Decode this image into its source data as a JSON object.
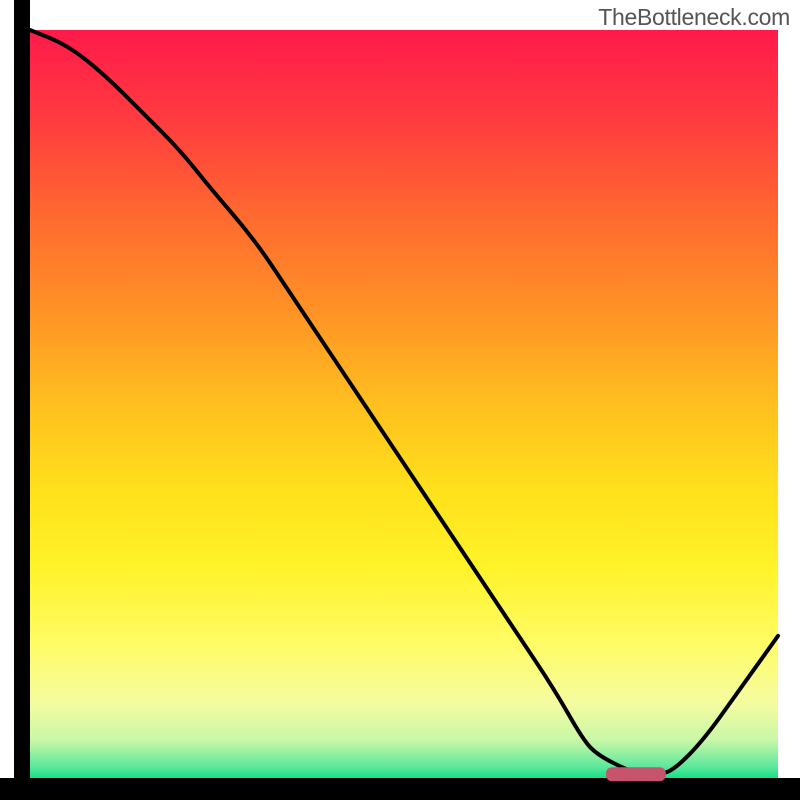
{
  "watermark": "TheBottleneck.com",
  "chart_data": {
    "type": "line",
    "title": "",
    "xlabel": "",
    "ylabel": "",
    "xlim": [
      0,
      100
    ],
    "ylim": [
      0,
      100
    ],
    "x": [
      0,
      5,
      10,
      15,
      20,
      24,
      30,
      35,
      40,
      45,
      50,
      55,
      60,
      65,
      70,
      74,
      76,
      80,
      82,
      84,
      86,
      90,
      95,
      100
    ],
    "y": [
      100,
      98,
      94,
      89,
      84,
      79,
      72,
      64.5,
      57,
      49.5,
      42,
      34.5,
      27,
      19.5,
      12,
      5,
      3,
      1,
      0.5,
      0.5,
      1,
      5,
      12,
      19
    ],
    "marker": {
      "x_range": [
        77,
        85
      ],
      "y": 0.5,
      "color": "#c5546c"
    },
    "gradient_stops": [
      {
        "offset": 0.0,
        "color": "#ff1a4a"
      },
      {
        "offset": 0.12,
        "color": "#ff3b40"
      },
      {
        "offset": 0.25,
        "color": "#ff6a2f"
      },
      {
        "offset": 0.38,
        "color": "#ff9426"
      },
      {
        "offset": 0.5,
        "color": "#ffbf1f"
      },
      {
        "offset": 0.62,
        "color": "#ffe21c"
      },
      {
        "offset": 0.72,
        "color": "#fff32a"
      },
      {
        "offset": 0.82,
        "color": "#fffc66"
      },
      {
        "offset": 0.9,
        "color": "#f5fca0"
      },
      {
        "offset": 0.95,
        "color": "#c8f7a8"
      },
      {
        "offset": 0.985,
        "color": "#5de89b"
      },
      {
        "offset": 1.0,
        "color": "#17df87"
      }
    ],
    "axis_color": "#000000",
    "line_color": "#000000",
    "line_width": 4
  }
}
